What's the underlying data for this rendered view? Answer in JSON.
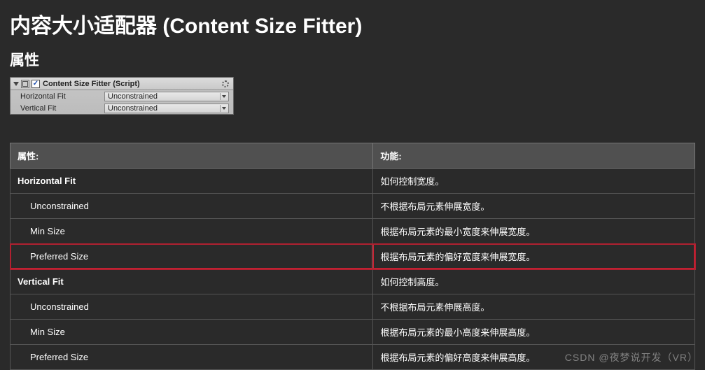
{
  "title": "内容大小适配器 (Content Size Fitter)",
  "section_properties_heading": "属性",
  "inspector": {
    "checkbox_checked": "✓",
    "component_title": "Content Size Fitter (Script)",
    "rows": [
      {
        "label": "Horizontal Fit",
        "value": "Unconstrained"
      },
      {
        "label": "Vertical Fit",
        "value": "Unconstrained"
      }
    ]
  },
  "table": {
    "header_prop": "属性:",
    "header_func": "功能:",
    "rows": [
      {
        "prop": "Horizontal Fit",
        "func": "如何控制宽度。",
        "bold": true
      },
      {
        "prop": "Unconstrained",
        "func": "不根据布局元素伸展宽度。",
        "indent": true
      },
      {
        "prop": "Min Size",
        "func": "根据布局元素的最小宽度来伸展宽度。",
        "indent": true
      },
      {
        "prop": "Preferred Size",
        "func": "根据布局元素的偏好宽度来伸展宽度。",
        "indent": true,
        "highlight": true
      },
      {
        "prop": "Vertical Fit",
        "func": "如何控制高度。",
        "bold": true
      },
      {
        "prop": "Unconstrained",
        "func": "不根据布局元素伸展高度。",
        "indent": true
      },
      {
        "prop": "Min Size",
        "func": "根据布局元素的最小高度来伸展高度。",
        "indent": true
      },
      {
        "prop": "Preferred Size",
        "func": "根据布局元素的偏好高度来伸展高度。",
        "indent": true
      }
    ]
  },
  "watermark": "CSDN @夜梦说开发（VR）"
}
